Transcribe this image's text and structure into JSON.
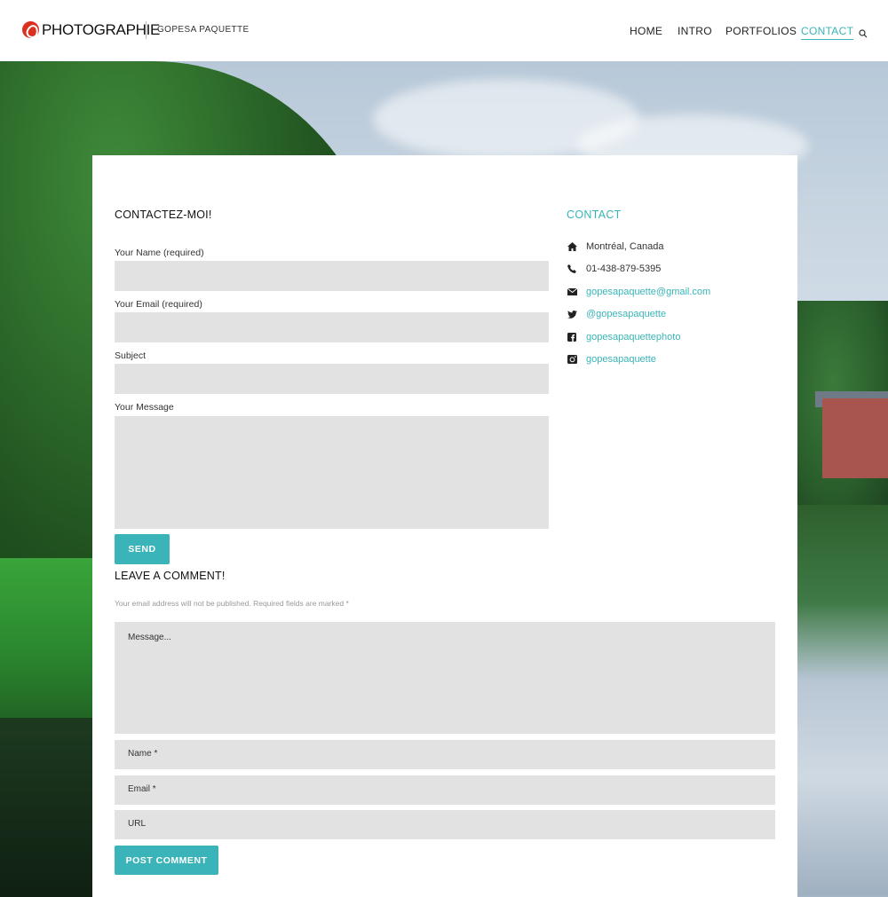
{
  "header": {
    "logo_text": "PHOTOGRAPHIE",
    "site_name": "GOPESA PAQUETTE",
    "nav": [
      {
        "label": "HOME",
        "active": false
      },
      {
        "label": "INTRO",
        "active": false
      },
      {
        "label": "PORTFOLIOS",
        "active": false
      },
      {
        "label": "CONTACT",
        "active": true
      }
    ],
    "search_icon": "search-icon"
  },
  "contact_form": {
    "title": "CONTACTEZ-MOI!",
    "name_label": "Your Name (required)",
    "email_label": "Your Email (required)",
    "subject_label": "Subject",
    "message_label": "Your Message",
    "name_value": "",
    "email_value": "",
    "subject_value": "",
    "message_value": "",
    "send_label": "SEND"
  },
  "contact_info": {
    "heading": "CONTACT",
    "items": [
      {
        "icon": "home-icon",
        "text": "Montréal, Canada",
        "link": false
      },
      {
        "icon": "phone-icon",
        "text": "01-438-879-5395",
        "link": false
      },
      {
        "icon": "envelope-icon",
        "text": "gopesapaquette@gmail.com",
        "link": true
      },
      {
        "icon": "twitter-icon",
        "text": "@gopesapaquette",
        "link": true
      },
      {
        "icon": "facebook-icon",
        "text": "gopesapaquettephoto",
        "link": true
      },
      {
        "icon": "instagram-icon",
        "text": "gopesapaquette",
        "link": true
      }
    ]
  },
  "comment_form": {
    "title": "LEAVE A COMMENT!",
    "note": "Your email address will not be published. Required fields are marked *",
    "message_placeholder": "Message...",
    "name_placeholder": "Name *",
    "email_placeholder": "Email *",
    "url_placeholder": "URL",
    "submit_label": "POST COMMENT"
  },
  "colors": {
    "accent": "#3ab4b8",
    "field_bg": "#e2e2e3",
    "logo_red": "#d9301f"
  }
}
